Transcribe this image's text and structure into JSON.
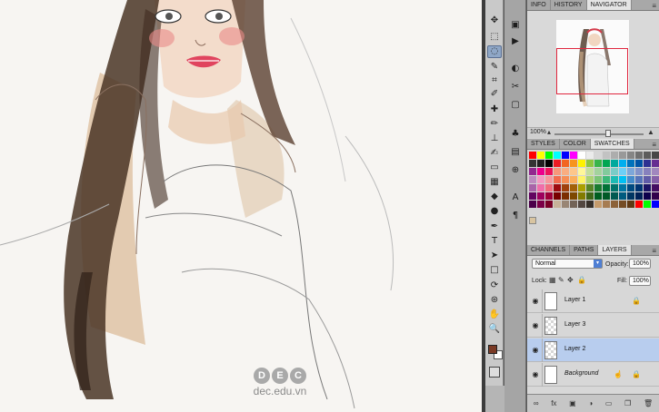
{
  "watermark": {
    "logo_letters": [
      "D",
      "E",
      "C"
    ],
    "text": "dec.edu.vn"
  },
  "tools": [
    "move-tool",
    "marquee-tool",
    "lasso-tool",
    "quick-select-tool",
    "crop-tool",
    "eyedropper-tool",
    "healing-brush-tool",
    "brush-tool",
    "clone-stamp-tool",
    "history-brush-tool",
    "eraser-tool",
    "gradient-tool",
    "blur-tool",
    "dodge-tool",
    "pen-tool",
    "type-tool",
    "path-selection-tool",
    "shape-tool",
    "3d-rotate-tool",
    "3d-orbit-tool",
    "hand-tool",
    "zoom-tool"
  ],
  "tool_glyphs": [
    "✥",
    "⬚",
    "◌",
    "✎",
    "⌗",
    "✐",
    "✚",
    "✏",
    "⊥",
    "✍",
    "▭",
    "▦",
    "◆",
    "●",
    "✒",
    "T",
    "➤",
    "□",
    "⟳",
    "⊛",
    "✋",
    "🔍"
  ],
  "colors": {
    "foreground": "#7a3a25",
    "background": "#ffffff",
    "accent_selected_layer": "#b8cdee",
    "navigator_box": "#e0263e"
  },
  "top_panel": {
    "tabs": [
      "INFO",
      "HISTORY",
      "NAVIGATOR"
    ],
    "active": "NAVIGATOR",
    "zoom": "100%"
  },
  "mid_panel": {
    "tabs": [
      "STYLES",
      "COLOR",
      "SWATCHES"
    ],
    "active": "SWATCHES"
  },
  "layers_panel": {
    "tabs": [
      "CHANNELS",
      "PATHS",
      "LAYERS"
    ],
    "active": "LAYERS",
    "blend_mode": "Normal",
    "opacity_label": "Opacity:",
    "opacity_value": "100%",
    "lock_label": "Lock:",
    "fill_label": "Fill:",
    "fill_value": "100%",
    "layers": [
      {
        "name": "Layer 1",
        "selected": false,
        "locked": true,
        "italic": false
      },
      {
        "name": "Layer 3",
        "selected": false,
        "locked": false,
        "italic": false
      },
      {
        "name": "Layer 2",
        "selected": true,
        "locked": false,
        "italic": false
      },
      {
        "name": "Background",
        "selected": false,
        "locked": true,
        "italic": true
      }
    ]
  }
}
